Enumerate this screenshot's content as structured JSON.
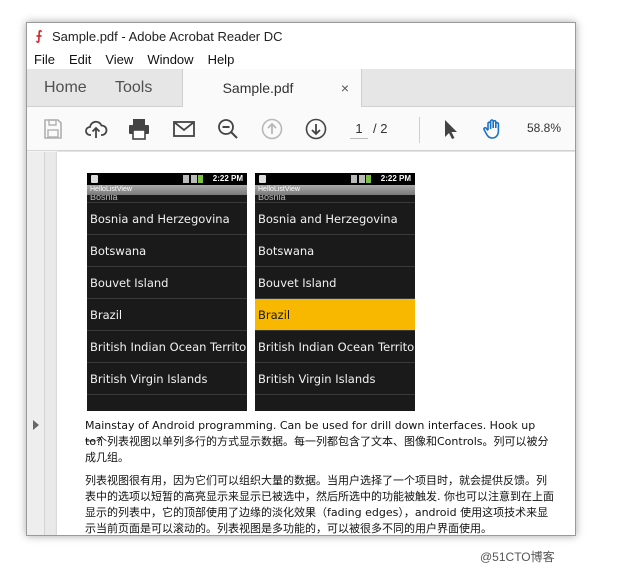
{
  "window": {
    "title": "Sample.pdf - Adobe Acrobat Reader DC"
  },
  "menu": [
    "File",
    "Edit",
    "View",
    "Window",
    "Help"
  ],
  "tabs": {
    "home": "Home",
    "tools": "Tools",
    "document": "Sample.pdf",
    "close": "×"
  },
  "toolbar": {
    "page_current": "1",
    "page_total": "/ 2",
    "zoom": "58.8%"
  },
  "phones": [
    {
      "status_time": "2:22 PM",
      "app_title": "HelloListView",
      "cut_item": "Bosnia",
      "items": [
        "Bosnia and Herzegovina",
        "Botswana",
        "Bouvet Island",
        "Brazil",
        "British Indian Ocean Territory",
        "British Virgin Islands"
      ],
      "selected_index": -1
    },
    {
      "status_time": "2:22 PM",
      "app_title": "HelloListView",
      "cut_item": "Bosnia",
      "items": [
        "Bosnia and Herzegovina",
        "Botswana",
        "Bouvet Island",
        "Brazil",
        "British Indian Ocean Territory",
        "British Virgin Islands"
      ],
      "selected_index": 3
    }
  ],
  "document_text": {
    "line1": "Mainstay of Android programming. Can be used for drill down interfaces. Hook up to?",
    "para1": "一个列表视图以单列多行的方式显示数据。每一列都包含了文本、图像和Controls。列可以被分成几组。",
    "para2": "列表视图很有用，因为它们可以组织大量的数据。当用户选择了一个项目时，就会提供反馈。列表中的选项以短暂的高亮显示来显示已被选中，然后所选中的功能被触发. 你也可以注意到在上面显示的列表中，它的顶部使用了边缘的淡化效果（fading edges），android 使用这项技术来显示当前页面是可以滚动的。列表视图是多功能的，可以被很多不同的用户界面使用。"
  },
  "watermark": "@51CTO博客",
  "colors": {
    "selected_row": "#f8b800",
    "pdf_red": "#d8232a",
    "hand_tool": "#1a73c8"
  }
}
